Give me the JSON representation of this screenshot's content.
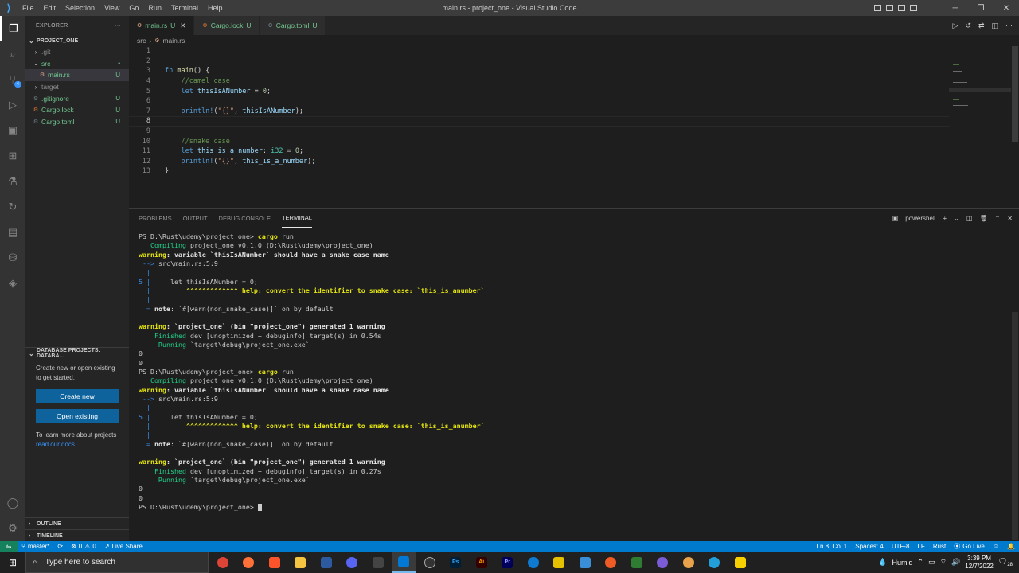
{
  "titlebar": {
    "menu": [
      "File",
      "Edit",
      "Selection",
      "View",
      "Go",
      "Run",
      "Terminal",
      "Help"
    ],
    "title": "main.rs - project_one - Visual Studio Code"
  },
  "activity": {
    "scm_badge": "4"
  },
  "sidebar": {
    "explorer_title": "EXPLORER",
    "more": "···",
    "project": "PROJECT_ONE",
    "tree": [
      {
        "label": ".git",
        "type": "folder",
        "status": "",
        "indent": 1
      },
      {
        "label": "src",
        "type": "folder-open",
        "status": "•",
        "indent": 1
      },
      {
        "label": "main.rs",
        "type": "file",
        "status": "U",
        "indent": 2,
        "selected": true
      },
      {
        "label": "target",
        "type": "folder",
        "status": "",
        "indent": 1
      },
      {
        "label": ".gitignore",
        "type": "file",
        "status": "U",
        "indent": 1
      },
      {
        "label": "Cargo.lock",
        "type": "file",
        "status": "U",
        "indent": 1
      },
      {
        "label": "Cargo.toml",
        "type": "file",
        "status": "U",
        "indent": 1
      }
    ],
    "db_title": "DATABASE PROJECTS: DATABA...",
    "db_text": "Create new or open existing to get started.",
    "db_create": "Create new",
    "db_open": "Open existing",
    "db_learn": "To learn more about projects ",
    "db_link": "read our docs",
    "db_period": ".",
    "outline": "OUTLINE",
    "timeline": "TIMELINE"
  },
  "tabs": [
    {
      "label": "main.rs",
      "status": "U",
      "active": true,
      "icon": "rust-icon"
    },
    {
      "label": "Cargo.lock",
      "status": "U",
      "active": false,
      "icon": "lock-icon"
    },
    {
      "label": "Cargo.toml",
      "status": "U",
      "active": false,
      "icon": "gear-icon"
    }
  ],
  "breadcrumb": {
    "folder": "src",
    "sep": "›",
    "file": "main.rs"
  },
  "editor": {
    "line_numbers": [
      "1",
      "2",
      "3",
      "4",
      "5",
      "6",
      "7",
      "8",
      "9",
      "10",
      "11",
      "12",
      "13"
    ],
    "lines": [
      [],
      [],
      [
        [
          "kw",
          "fn "
        ],
        [
          "fn",
          "main"
        ],
        [
          "p",
          "() {"
        ]
      ],
      [
        [
          "cmt",
          "    //camel case"
        ]
      ],
      [
        [
          "kw",
          "    let "
        ],
        [
          "var",
          "thisIsANumber"
        ],
        [
          "p",
          " = "
        ],
        [
          "num",
          "0"
        ],
        [
          "p",
          ";"
        ]
      ],
      [],
      [
        [
          "mac",
          "    println!"
        ],
        [
          "p",
          "("
        ],
        [
          "str",
          "\"{}\""
        ],
        [
          "p",
          ", "
        ],
        [
          "var",
          "thisIsANumber"
        ],
        [
          "p",
          ");"
        ]
      ],
      [],
      [],
      [
        [
          "cmt",
          "    //snake case"
        ]
      ],
      [
        [
          "kw",
          "    let "
        ],
        [
          "var",
          "this_is_a_number"
        ],
        [
          "p",
          ": "
        ],
        [
          "ty",
          "i32"
        ],
        [
          "p",
          " = "
        ],
        [
          "num",
          "0"
        ],
        [
          "p",
          ";"
        ]
      ],
      [
        [
          "mac",
          "    println!"
        ],
        [
          "p",
          "("
        ],
        [
          "str",
          "\"{}\""
        ],
        [
          "p",
          ", "
        ],
        [
          "var",
          "this_is_a_number"
        ],
        [
          "p",
          ");"
        ]
      ],
      [
        [
          "p",
          "}"
        ]
      ]
    ]
  },
  "panel": {
    "tabs": [
      "PROBLEMS",
      "OUTPUT",
      "DEBUG CONSOLE",
      "TERMINAL"
    ],
    "shell": "powershell",
    "terminal": [
      [
        [
          "p",
          "PS D:\\Rust\\udemy\\project_one> "
        ],
        [
          "y",
          "cargo"
        ],
        [
          "p",
          " run"
        ]
      ],
      [
        [
          "g",
          "   Compiling"
        ],
        [
          "p",
          " project_one v0.1.0 (D:\\Rust\\udemy\\project_one)"
        ]
      ],
      [
        [
          "y",
          "warning"
        ],
        [
          "w",
          ": variable `thisIsANumber` should have a snake case name"
        ]
      ],
      [
        [
          "b",
          " --> "
        ],
        [
          "p",
          "src\\main.rs:5:9"
        ]
      ],
      [
        [
          "b",
          "  |"
        ]
      ],
      [
        [
          "b",
          "5 |"
        ],
        [
          "p",
          "     let thisIsANumber = 0;"
        ]
      ],
      [
        [
          "b",
          "  |"
        ],
        [
          "y",
          "         ^^^^^^^^^^^^^ help: convert the identifier to snake case: `this_is_anumber`"
        ]
      ],
      [
        [
          "b",
          "  |"
        ]
      ],
      [
        [
          "b",
          "  = "
        ],
        [
          "w",
          "note"
        ],
        [
          "p",
          ": `#[warn(non_snake_case)]` on by default"
        ]
      ],
      [],
      [
        [
          "y",
          "warning"
        ],
        [
          "w",
          ": `project_one` (bin \"project_one\") generated 1 warning"
        ]
      ],
      [
        [
          "g",
          "    Finished"
        ],
        [
          "p",
          " dev [unoptimized + debuginfo] target(s) in 0.54s"
        ]
      ],
      [
        [
          "g",
          "     Running"
        ],
        [
          "p",
          " `target\\debug\\project_one.exe`"
        ]
      ],
      [
        [
          "p",
          "0"
        ]
      ],
      [
        [
          "p",
          "0"
        ]
      ],
      [
        [
          "p",
          "PS D:\\Rust\\udemy\\project_one> "
        ],
        [
          "y",
          "cargo"
        ],
        [
          "p",
          " run"
        ]
      ],
      [
        [
          "g",
          "   Compiling"
        ],
        [
          "p",
          " project_one v0.1.0 (D:\\Rust\\udemy\\project_one)"
        ]
      ],
      [
        [
          "y",
          "warning"
        ],
        [
          "w",
          ": variable `thisIsANumber` should have a snake case name"
        ]
      ],
      [
        [
          "b",
          " --> "
        ],
        [
          "p",
          "src\\main.rs:5:9"
        ]
      ],
      [
        [
          "b",
          "  |"
        ]
      ],
      [
        [
          "b",
          "5 |"
        ],
        [
          "p",
          "     let thisIsANumber = 0;"
        ]
      ],
      [
        [
          "b",
          "  |"
        ],
        [
          "y",
          "         ^^^^^^^^^^^^^ help: convert the identifier to snake case: `this_is_anumber`"
        ]
      ],
      [
        [
          "b",
          "  |"
        ]
      ],
      [
        [
          "b",
          "  = "
        ],
        [
          "w",
          "note"
        ],
        [
          "p",
          ": `#[warn(non_snake_case)]` on by default"
        ]
      ],
      [],
      [
        [
          "y",
          "warning"
        ],
        [
          "w",
          ": `project_one` (bin \"project_one\") generated 1 warning"
        ]
      ],
      [
        [
          "g",
          "    Finished"
        ],
        [
          "p",
          " dev [unoptimized + debuginfo] target(s) in 0.27s"
        ]
      ],
      [
        [
          "g",
          "     Running"
        ],
        [
          "p",
          " `target\\debug\\project_one.exe`"
        ]
      ],
      [
        [
          "p",
          "0"
        ]
      ],
      [
        [
          "p",
          "0"
        ]
      ],
      [
        [
          "p",
          "PS D:\\Rust\\udemy\\project_one> "
        ]
      ]
    ]
  },
  "statusbar": {
    "branch": "master*",
    "errors": "0",
    "warnings": "0",
    "liveshare": "Live Share",
    "position": "Ln 8, Col 1",
    "spaces": "Spaces: 4",
    "encoding": "UTF-8",
    "eol": "LF",
    "language": "Rust",
    "golive": "Go Live"
  },
  "taskbar": {
    "search_placeholder": "Type here to search",
    "weather": "Humid",
    "time": "3:39 PM",
    "date": "12/7/2022",
    "notifications": "28"
  },
  "colors": {
    "accent": "#007acc",
    "sidebar": "#252526",
    "editor": "#1e1e1e"
  }
}
